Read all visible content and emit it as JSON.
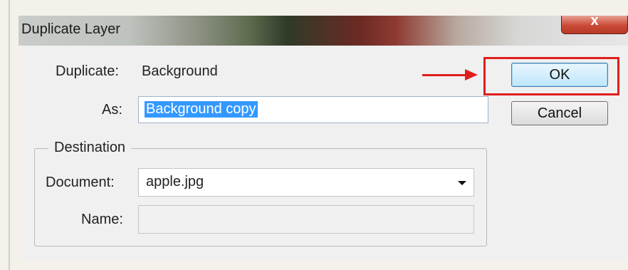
{
  "window": {
    "title": "Duplicate Layer",
    "close_glyph": "x"
  },
  "form": {
    "duplicate_label": "Duplicate:",
    "duplicate_value": "Background",
    "as_label": "As:",
    "as_value": "Background copy"
  },
  "buttons": {
    "ok": "OK",
    "cancel": "Cancel"
  },
  "destination": {
    "legend": "Destination",
    "document_label": "Document:",
    "document_value": "apple.jpg",
    "name_label": "Name:",
    "name_value": ""
  },
  "annotation": {
    "highlight_color": "#e01e1e"
  }
}
